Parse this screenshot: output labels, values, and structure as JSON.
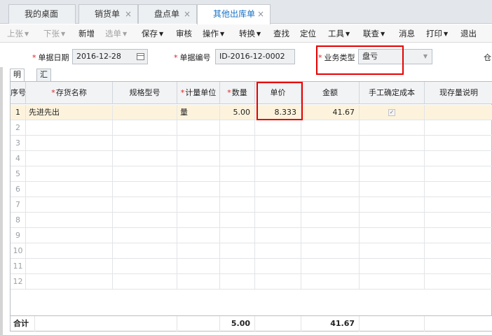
{
  "tabs": [
    {
      "label": "我的桌面",
      "closable": false,
      "active": false
    },
    {
      "label": "销货单",
      "closable": true,
      "active": false
    },
    {
      "label": "盘点单",
      "closable": true,
      "active": false
    },
    {
      "label": "其他出库单",
      "closable": true,
      "active": true
    }
  ],
  "close_glyph": "×",
  "toolbar": {
    "prev": "上张",
    "next": "下张",
    "new": "新增",
    "select": "选单",
    "save": "保存",
    "audit": "审核",
    "operate": "操作",
    "convert": "转换",
    "find": "查找",
    "locate": "定位",
    "tools": "工具",
    "link": "联查",
    "message": "消息",
    "print": "打印",
    "exit": "退出"
  },
  "form": {
    "required_mark": "*",
    "date_label": "单据日期",
    "date_value": "2016-12-28",
    "number_label": "单据编号",
    "number_value": "ID-2016-12-0002",
    "biz_type_label": "业务类型",
    "biz_type_value": "盘亏",
    "warehouse_label_partial": "仓"
  },
  "subtabs": [
    "明细",
    "汇总"
  ],
  "table": {
    "headers": {
      "index": "序号",
      "item_name": "存货名称",
      "spec": "规格型号",
      "unit": "计量单位",
      "qty": "数量",
      "price": "单价",
      "amount": "金额",
      "manual_cost": "手工确定成本",
      "stock_note": "现存量说明"
    },
    "rows": [
      {
        "index": "1",
        "item_name": "先进先出",
        "spec": "",
        "unit": "量",
        "qty": "5.00",
        "price": "8.333",
        "amount": "41.67",
        "manual_cost": true,
        "stock_note": ""
      },
      {
        "index": "2"
      },
      {
        "index": "3"
      },
      {
        "index": "4"
      },
      {
        "index": "5"
      },
      {
        "index": "6"
      },
      {
        "index": "7"
      },
      {
        "index": "8"
      },
      {
        "index": "9"
      },
      {
        "index": "10"
      },
      {
        "index": "11"
      },
      {
        "index": "12"
      }
    ],
    "footer": {
      "label": "合计",
      "qty": "5.00",
      "amount": "41.67"
    }
  },
  "checkbox_glyph": "✓",
  "colors": {
    "accent": "#1a73c6",
    "highlight_box": "#e60000",
    "selected_row": "#fdf3dd",
    "required": "#e02020"
  }
}
